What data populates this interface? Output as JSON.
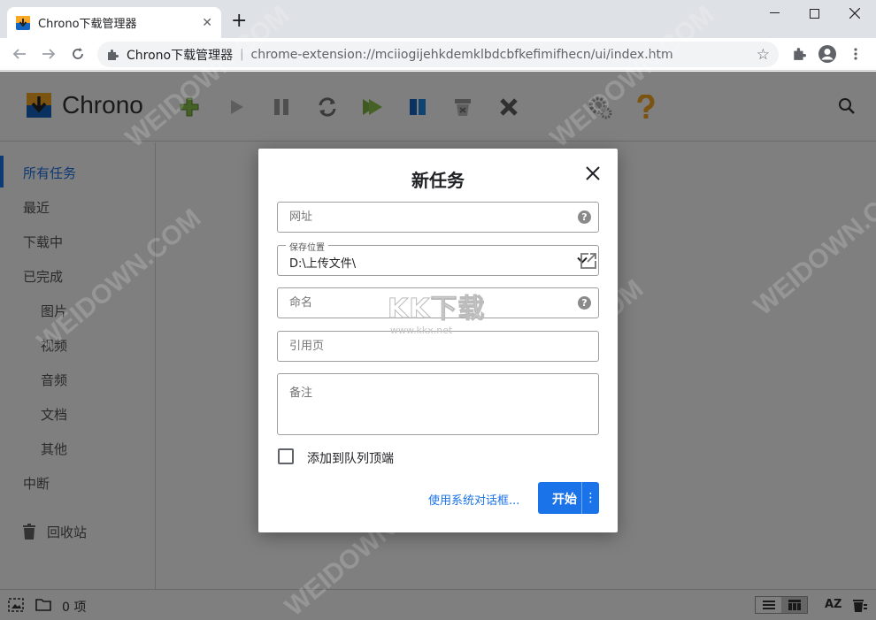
{
  "browser": {
    "tab_title": "Chrono下载管理器",
    "omnibox_origin": "Chrono下载管理器",
    "omnibox_url": "chrome-extension://mciiogijehkdemklbdcbfkefimifhecn/ui/index.htm"
  },
  "app": {
    "name": "Chrono",
    "toolbar_icons": [
      "add-icon",
      "play-icon",
      "pause-icon",
      "refresh-icon",
      "play-all-icon",
      "pause-all-icon",
      "clear-icon",
      "delete-icon",
      "settings-icon",
      "help-icon"
    ]
  },
  "sidebar": {
    "items": [
      {
        "label": "所有任务"
      },
      {
        "label": "最近"
      },
      {
        "label": "下载中"
      },
      {
        "label": "已完成"
      },
      {
        "label": "图片"
      },
      {
        "label": "视频"
      },
      {
        "label": "音频"
      },
      {
        "label": "文档"
      },
      {
        "label": "其他"
      },
      {
        "label": "中断"
      },
      {
        "label": "回收站"
      }
    ]
  },
  "status": {
    "count": "0 项"
  },
  "dialog": {
    "title": "新任务",
    "url_placeholder": "网址",
    "save_location_legend": "保存位置",
    "save_location_value": "D:\\上传文件\\",
    "name_placeholder": "命名",
    "referrer_placeholder": "引用页",
    "note_placeholder": "备注",
    "add_to_top_label": "添加到队列顶端",
    "system_dialog_link": "使用系统对话框...",
    "start_label": "开始"
  },
  "watermark": {
    "logo": "KK下载",
    "site": "www.kkx.net",
    "text": "WEIDOWN.COM"
  },
  "colors": {
    "accent": "#1a73e8",
    "overlay": "rgba(0,0,0,0.5)"
  }
}
